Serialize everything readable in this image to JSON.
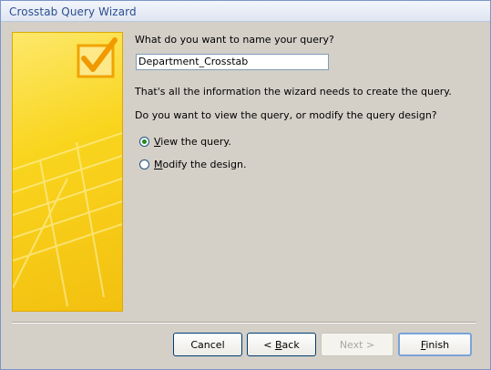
{
  "window": {
    "title": "Crosstab Query Wizard"
  },
  "side_panel": {
    "icon": "checkmark-graphic"
  },
  "name_prompt": "What do you want to name your query?",
  "query_name_value": "Department_Crosstab",
  "info_text": "That's all the information the wizard needs to create the query.",
  "question_text": "Do you want to view the query, or modify the query design?",
  "options": [
    {
      "label": "View the query.",
      "accel": "V",
      "rest": "iew the query.",
      "selected": true
    },
    {
      "label": "Modify the design.",
      "accel": "M",
      "rest": "odify the design.",
      "selected": false
    }
  ],
  "buttons": {
    "cancel": "Cancel",
    "back_accel": "B",
    "back_prefix": "< ",
    "back_rest": "ack",
    "next": "Next >",
    "finish_accel": "F",
    "finish_rest": "inish"
  },
  "colors": {
    "panel_yellow": "#f9d51e",
    "title_text": "#2b4f8f",
    "dialog_bg": "#d4d0c8"
  }
}
